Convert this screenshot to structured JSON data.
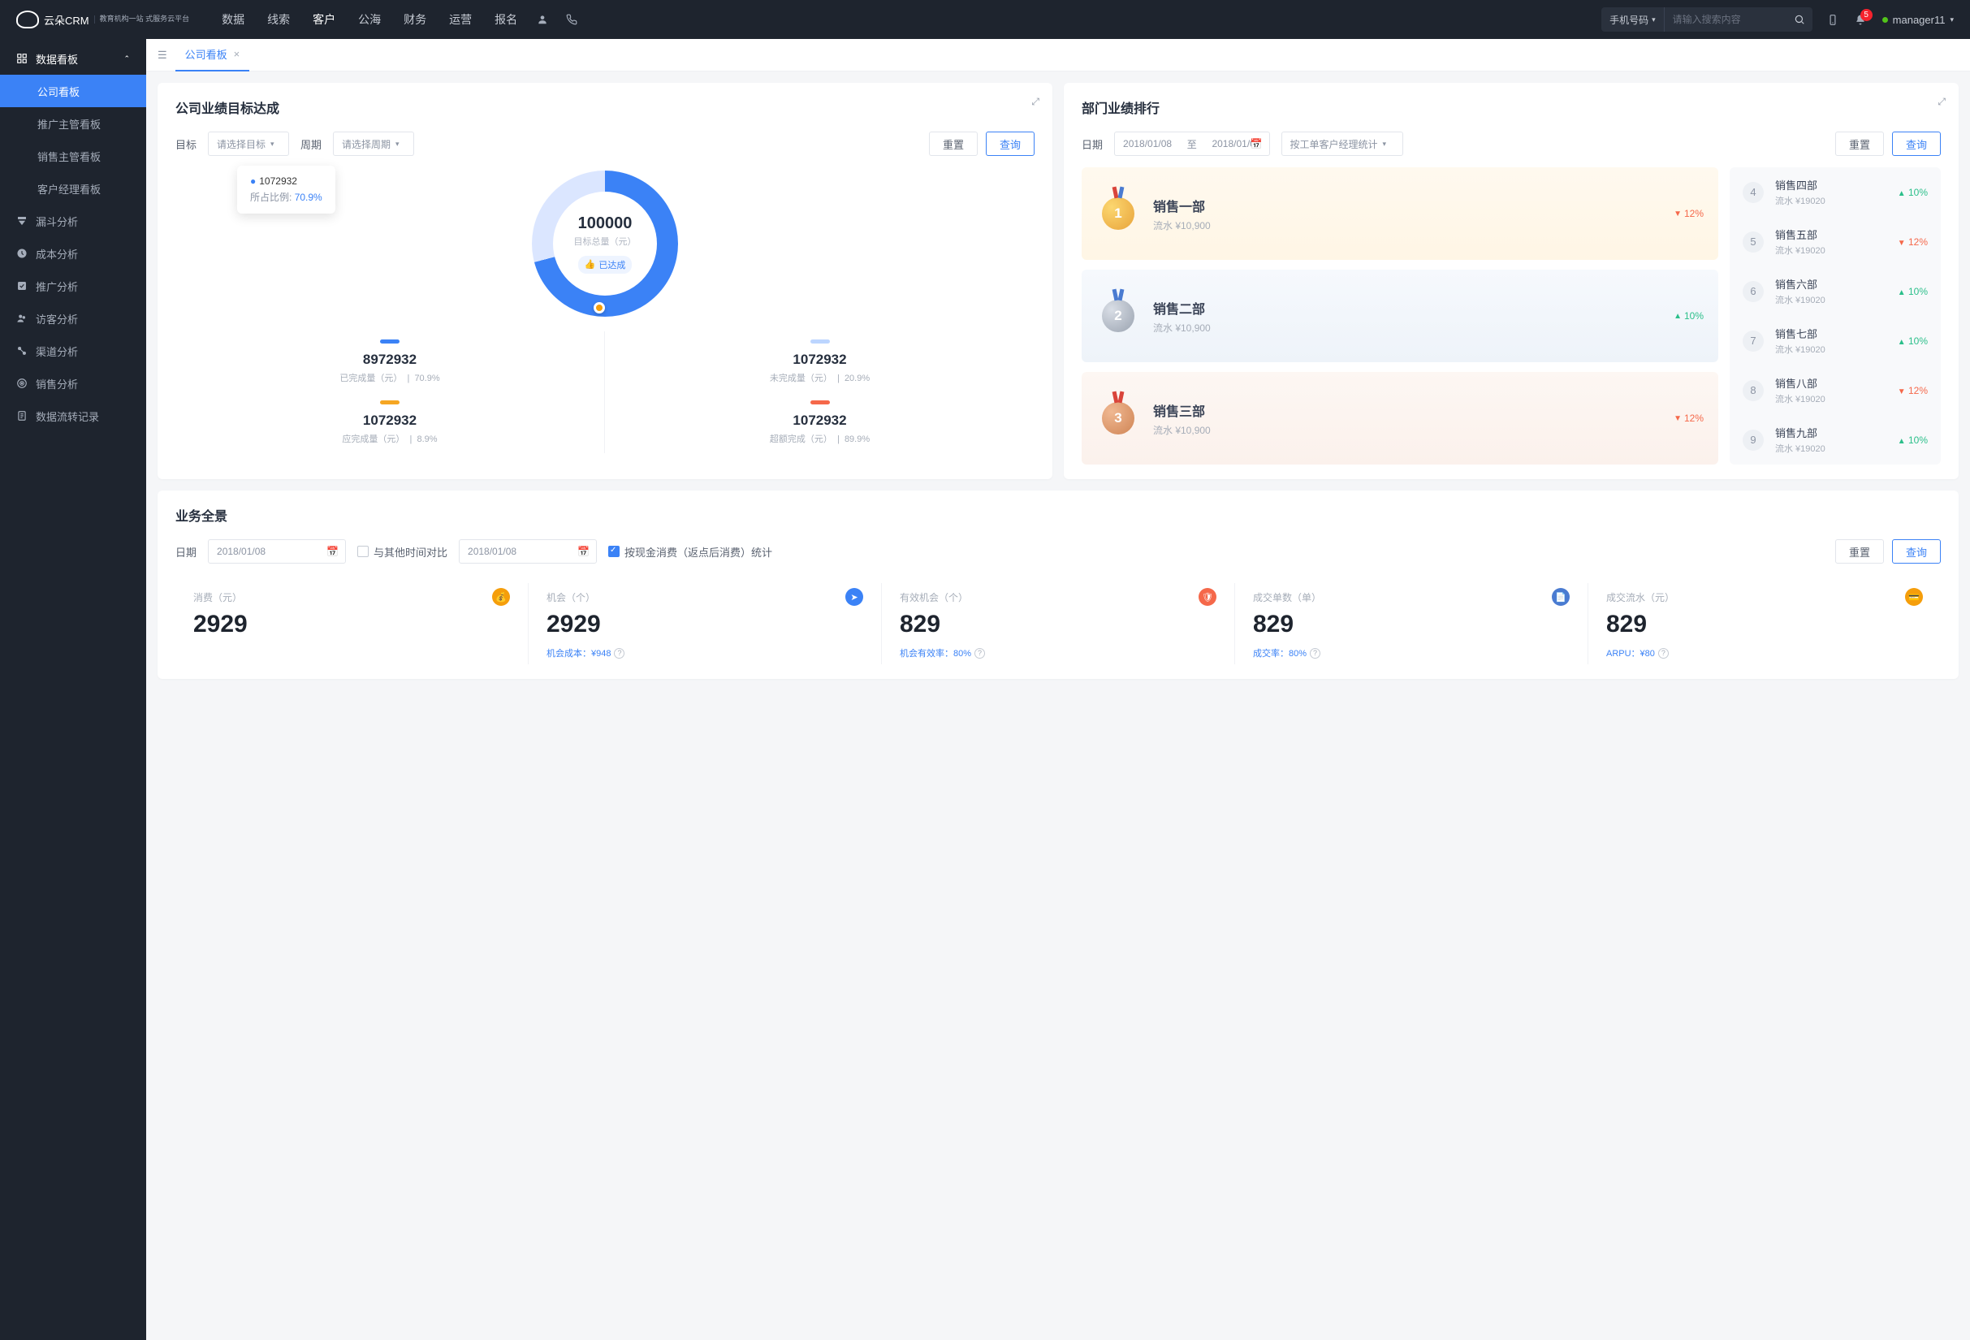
{
  "brand": {
    "name": "云朵CRM",
    "sub": "教育机构一站\n式服务云平台"
  },
  "topnav": [
    "数据",
    "线索",
    "客户",
    "公海",
    "财务",
    "运营",
    "报名"
  ],
  "topnav_active": 2,
  "search": {
    "selector": "手机号码",
    "placeholder": "请输入搜索内容"
  },
  "notif_count": "5",
  "user": {
    "name": "manager11"
  },
  "sidebar": {
    "header": "数据看板",
    "subs": [
      "公司看板",
      "推广主管看板",
      "销售主管看板",
      "客户经理看板"
    ],
    "active_sub": 0,
    "items": [
      "漏斗分析",
      "成本分析",
      "推广分析",
      "访客分析",
      "渠道分析",
      "销售分析",
      "数据流转记录"
    ]
  },
  "tab": {
    "label": "公司看板"
  },
  "goal": {
    "title": "公司业绩目标达成",
    "target_label": "目标",
    "target_ph": "请选择目标",
    "period_label": "周期",
    "period_ph": "请选择周期",
    "reset": "重置",
    "query": "查询",
    "tooltip_value": "1072932",
    "tooltip_label": "所占比例:",
    "tooltip_pct": "70.9%",
    "center_value": "100000",
    "center_label": "目标总量（元）",
    "center_chip": "已达成",
    "stats": [
      {
        "color": "#3b82f6",
        "value": "8972932",
        "label": "已完成量（元）",
        "pct": "70.9%"
      },
      {
        "color": "#bcd5ff",
        "value": "1072932",
        "label": "未完成量（元）",
        "pct": "20.9%"
      },
      {
        "color": "#f5a623",
        "value": "1072932",
        "label": "应完成量（元）",
        "pct": "8.9%"
      },
      {
        "color": "#f5684a",
        "value": "1072932",
        "label": "超额完成（元）",
        "pct": "89.9%"
      }
    ]
  },
  "rank": {
    "title": "部门业绩排行",
    "date_label": "日期",
    "date_from": "2018/01/08",
    "date_sep": "至",
    "date_to": "2018/01/08",
    "group_by": "按工单客户经理统计",
    "reset": "重置",
    "query": "查询",
    "podium": [
      {
        "rank": "1",
        "name": "销售一部",
        "sub": "流水 ¥10,900",
        "pct": "12%",
        "dir": "down"
      },
      {
        "rank": "2",
        "name": "销售二部",
        "sub": "流水 ¥10,900",
        "pct": "10%",
        "dir": "up"
      },
      {
        "rank": "3",
        "name": "销售三部",
        "sub": "流水 ¥10,900",
        "pct": "12%",
        "dir": "down"
      }
    ],
    "list": [
      {
        "rank": "4",
        "name": "销售四部",
        "sub": "流水 ¥19020",
        "pct": "10%",
        "dir": "up"
      },
      {
        "rank": "5",
        "name": "销售五部",
        "sub": "流水 ¥19020",
        "pct": "12%",
        "dir": "down"
      },
      {
        "rank": "6",
        "name": "销售六部",
        "sub": "流水 ¥19020",
        "pct": "10%",
        "dir": "up"
      },
      {
        "rank": "7",
        "name": "销售七部",
        "sub": "流水 ¥19020",
        "pct": "10%",
        "dir": "up"
      },
      {
        "rank": "8",
        "name": "销售八部",
        "sub": "流水 ¥19020",
        "pct": "12%",
        "dir": "down"
      },
      {
        "rank": "9",
        "name": "销售九部",
        "sub": "流水 ¥19020",
        "pct": "10%",
        "dir": "up"
      }
    ]
  },
  "overview": {
    "title": "业务全景",
    "date_label": "日期",
    "date1": "2018/01/08",
    "compare_label": "与其他时间对比",
    "date2": "2018/01/08",
    "cash_label": "按现金消费（返点后消费）统计",
    "reset": "重置",
    "query": "查询",
    "kpis": [
      {
        "label": "消费（元）",
        "value": "2929",
        "icon": "bag",
        "color": "#f59e0b",
        "sub": ""
      },
      {
        "label": "机会（个）",
        "value": "2929",
        "icon": "nav",
        "color": "#3b82f6",
        "sub_label": "机会成本：",
        "sub_val": "¥948"
      },
      {
        "label": "有效机会（个）",
        "value": "829",
        "icon": "shield",
        "color": "#f5684a",
        "sub_label": "机会有效率：",
        "sub_val": "80%"
      },
      {
        "label": "成交单数（单）",
        "value": "829",
        "icon": "doc",
        "color": "#4a7bd1",
        "sub_label": "成交率：",
        "sub_val": "80%"
      },
      {
        "label": "成交流水（元）",
        "value": "829",
        "icon": "card",
        "color": "#f59e0b",
        "sub_label": "ARPU：",
        "sub_val": "¥80"
      }
    ]
  },
  "chart_data": {
    "type": "pie",
    "title": "公司业绩目标达成",
    "total": 100000,
    "series": [
      {
        "name": "已完成量（元）",
        "value": 8972932,
        "pct": 70.9
      },
      {
        "name": "未完成量（元）",
        "value": 1072932,
        "pct": 20.9
      },
      {
        "name": "应完成量（元）",
        "value": 1072932,
        "pct": 8.9
      },
      {
        "name": "超额完成（元）",
        "value": 1072932,
        "pct": 89.9
      }
    ]
  }
}
